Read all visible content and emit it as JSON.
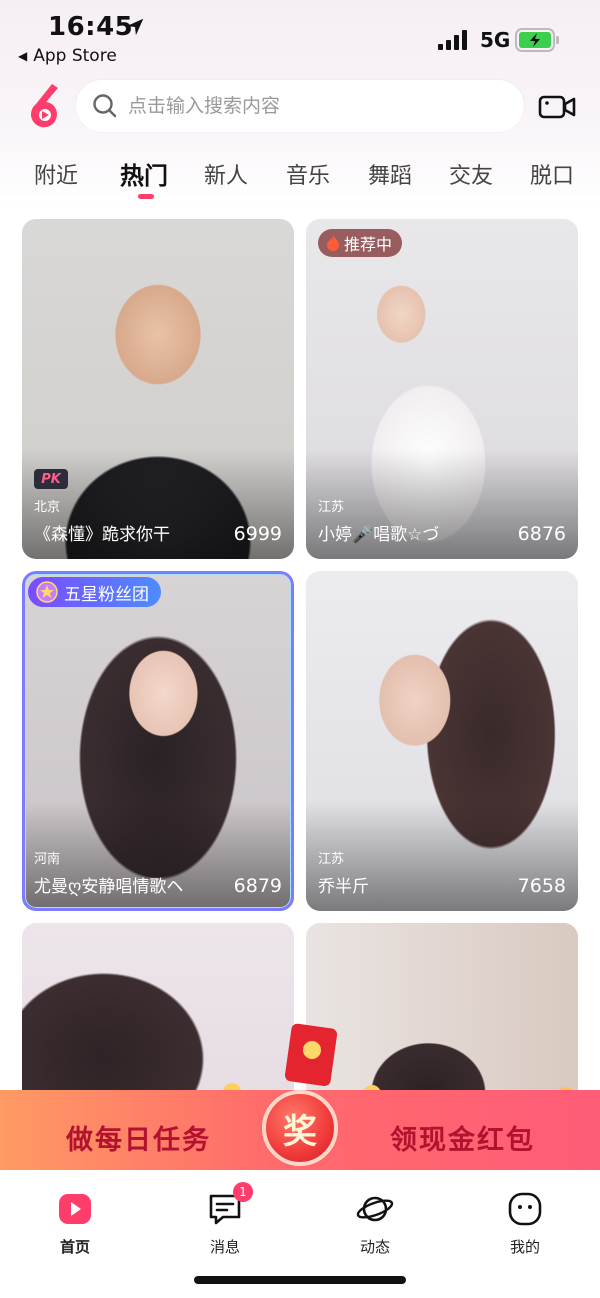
{
  "status_bar": {
    "time": "16:45",
    "back_label": "App Store",
    "network": "5G"
  },
  "header": {
    "search_placeholder": "点击输入搜索内容"
  },
  "tabs": [
    {
      "label": "附近",
      "active": false
    },
    {
      "label": "热门",
      "active": true
    },
    {
      "label": "新人",
      "active": false
    },
    {
      "label": "音乐",
      "active": false
    },
    {
      "label": "舞蹈",
      "active": false
    },
    {
      "label": "交友",
      "active": false
    },
    {
      "label": "脱口",
      "active": false
    }
  ],
  "cards": [
    {
      "location": "北京",
      "title": "《森懂》跪求你干",
      "count": "6999",
      "badge": "PK"
    },
    {
      "location": "江苏",
      "title": "小婷🎤唱歌☆づ",
      "count": "6876",
      "badge": "推荐中"
    },
    {
      "location": "河南",
      "title": "尤曼ღ安静唱情歌ヘ",
      "count": "6879",
      "badge": "五星粉丝团"
    },
    {
      "location": "江苏",
      "title": "乔半斤",
      "count": "7658",
      "badge": ""
    },
    {
      "location": "",
      "title": "",
      "count": "",
      "badge": ""
    },
    {
      "location": "",
      "title": "",
      "count": "",
      "badge": ""
    }
  ],
  "promo": {
    "left_text": "做每日任务",
    "center_text": "奖",
    "right_text": "领现金红包"
  },
  "bottom_nav": [
    {
      "label": "首页",
      "icon": "play-home-icon",
      "active": true
    },
    {
      "label": "消息",
      "icon": "message-icon",
      "badge": "1"
    },
    {
      "label": "动态",
      "icon": "planet-icon"
    },
    {
      "label": "我的",
      "icon": "profile-face-icon"
    }
  ],
  "colors": {
    "accent": "#ff3d6a",
    "promo_start": "#ff9a64",
    "promo_end": "#ff5c78",
    "promo_text": "#b3122e"
  }
}
